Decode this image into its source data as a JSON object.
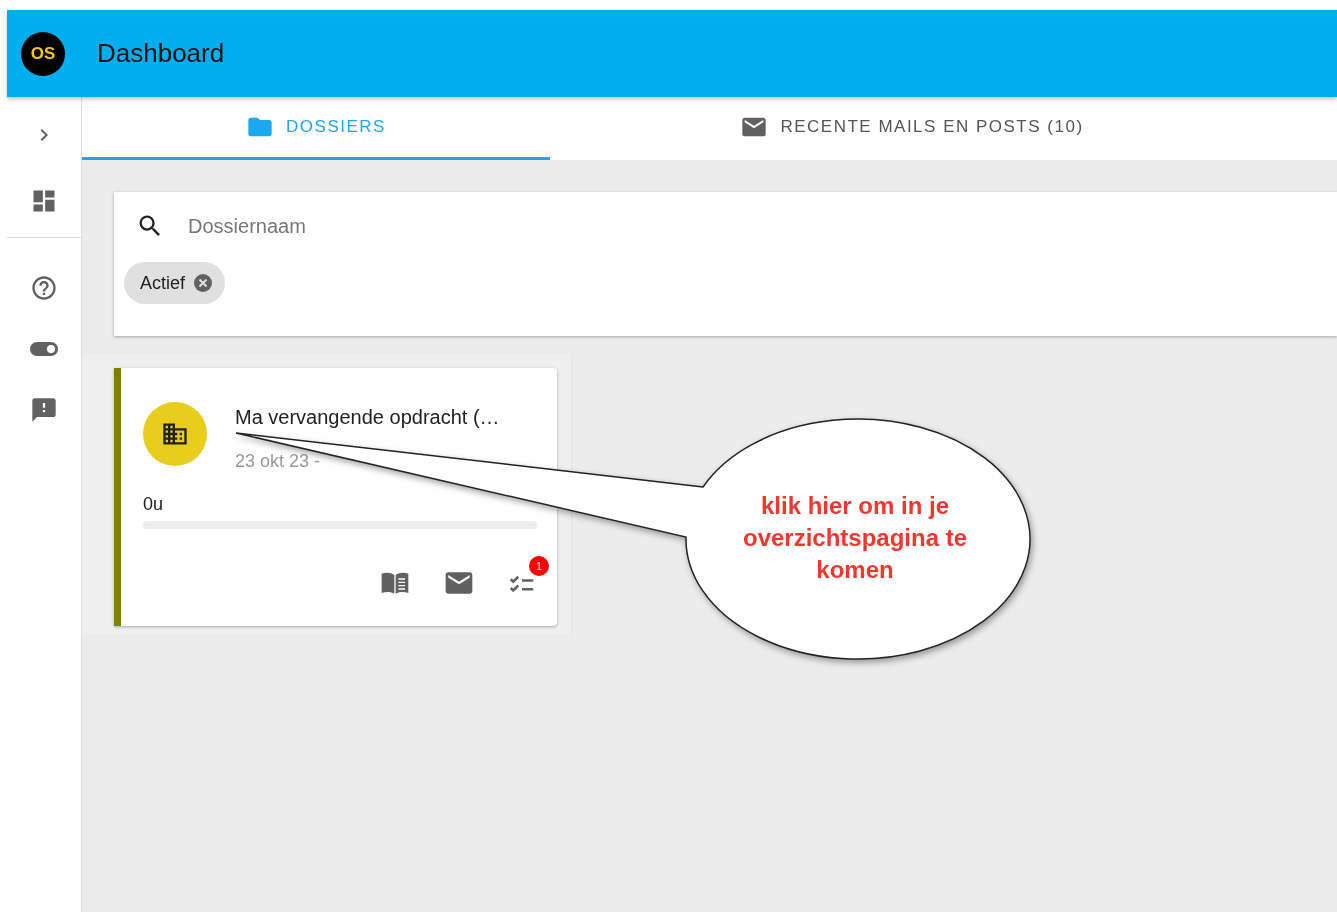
{
  "app_bar": {
    "logo": "OS",
    "title": "Dashboard"
  },
  "sidebar": {
    "items": [
      {
        "kind": "expand"
      },
      {
        "kind": "dashboard"
      },
      {
        "kind": "divider"
      },
      {
        "kind": "help"
      },
      {
        "kind": "toggle"
      },
      {
        "kind": "feedback"
      }
    ]
  },
  "tabs": [
    {
      "label": "DOSSIERS",
      "selected": true
    },
    {
      "label": "RECENTE MAILS EN POSTS (10)",
      "selected": false
    }
  ],
  "search": {
    "placeholder": "Dossiernaam",
    "chips": [
      "Actief"
    ]
  },
  "dossiers": [
    {
      "title": "Ma vervangende opdracht (…",
      "subtitle": "23 okt 23 -",
      "color": "#808000",
      "hours": "0u",
      "level": 0,
      "task_badge": "1"
    }
  ],
  "callout": {
    "text": "klik hier om in je overzichtspagina te komen"
  }
}
